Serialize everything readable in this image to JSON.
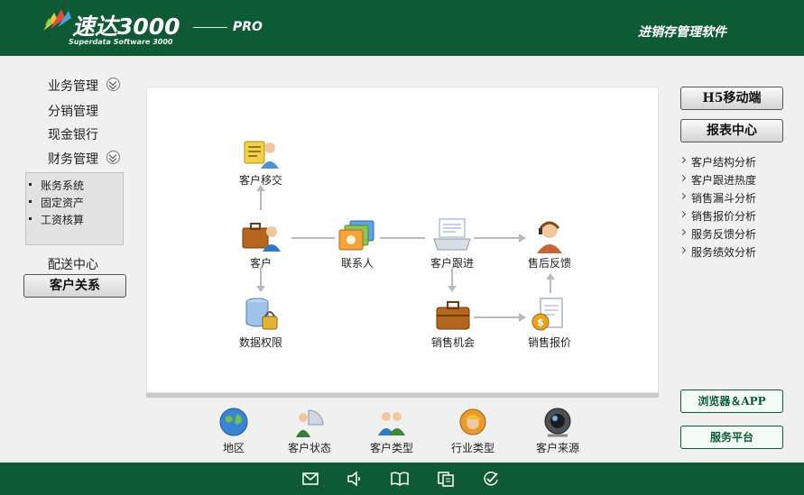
{
  "header": {
    "app_name": "速达3000",
    "app_subtitle": "Superdata Software 3000",
    "edition": "PRO",
    "tagline": "进销存管理软件"
  },
  "sidebar": {
    "items": [
      {
        "label": "业务管理",
        "expandable": true
      },
      {
        "label": "分销管理",
        "expandable": false
      },
      {
        "label": "现金银行",
        "expandable": false
      },
      {
        "label": "财务管理",
        "expandable": true
      }
    ],
    "finance_submenu": [
      "账务系统",
      "固定资产",
      "工资核算"
    ],
    "delivery": "配送中心",
    "active": "客户关系"
  },
  "flow": {
    "nodes": {
      "transfer": "客户移交",
      "customer": "客户",
      "contact": "联系人",
      "followup": "客户跟进",
      "aftersale": "售后反馈",
      "permission": "数据权限",
      "opportunity": "销售机会",
      "quote": "销售报价"
    }
  },
  "categories": [
    "地区",
    "客户状态",
    "客户类型",
    "行业类型",
    "客户来源"
  ],
  "right_panel": {
    "mobile_button": "H5移动端",
    "report_button": "报表中心",
    "reports": [
      "客户结构分析",
      "客户跟进热度",
      "销售漏斗分析",
      "销售报价分析",
      "服务反馈分析",
      "服务绩效分析"
    ],
    "browser_button": "浏览器＆APP",
    "service_button": "服务平台"
  },
  "footer_icons": [
    "mail-icon",
    "speaker-icon",
    "book-icon",
    "notes-icon",
    "check-icon"
  ],
  "colors": {
    "header_green": "#0e5a34",
    "background": "#f0f0f0",
    "panel": "#ffffff",
    "arrow": "#b9b9b9"
  }
}
